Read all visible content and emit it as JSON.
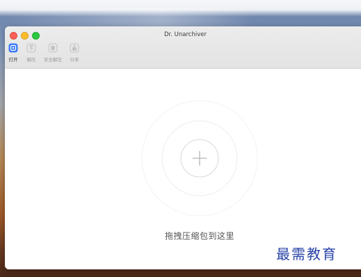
{
  "window": {
    "title": "Dr. Unarchiver"
  },
  "toolbar": {
    "items": [
      {
        "label": "打开",
        "icon": "open-icon",
        "active": true
      },
      {
        "label": "解压",
        "icon": "extract-icon",
        "active": false
      },
      {
        "label": "安全解压",
        "icon": "safe-extract-icon",
        "active": false
      },
      {
        "label": "分享",
        "icon": "share-icon",
        "active": false
      }
    ]
  },
  "main": {
    "drop_text": "拖拽压缩包到这里"
  },
  "watermark": {
    "text": "最需教育"
  },
  "colors": {
    "accent": "#3a7bf6",
    "inactive_icon": "#c4c4c4",
    "watermark": "#2a44a8"
  }
}
